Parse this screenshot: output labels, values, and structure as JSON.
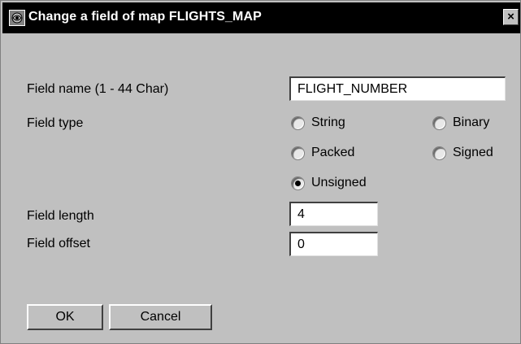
{
  "window": {
    "title": "Change a field of map FLIGHTS_MAP",
    "close_glyph": "×"
  },
  "form": {
    "field_name_label": "Field name (1 - 44 Char)",
    "field_name_value": "FLIGHT_NUMBER",
    "field_type_label": "Field type",
    "field_types": [
      {
        "label": "String",
        "selected": false
      },
      {
        "label": "Binary",
        "selected": false
      },
      {
        "label": "Packed",
        "selected": false
      },
      {
        "label": "Signed",
        "selected": false
      },
      {
        "label": "Unsigned",
        "selected": true
      }
    ],
    "field_length_label": "Field length",
    "field_length_value": "4",
    "field_offset_label": "Field offset",
    "field_offset_value": "0"
  },
  "buttons": {
    "ok_label": "OK",
    "cancel_label": "Cancel"
  }
}
